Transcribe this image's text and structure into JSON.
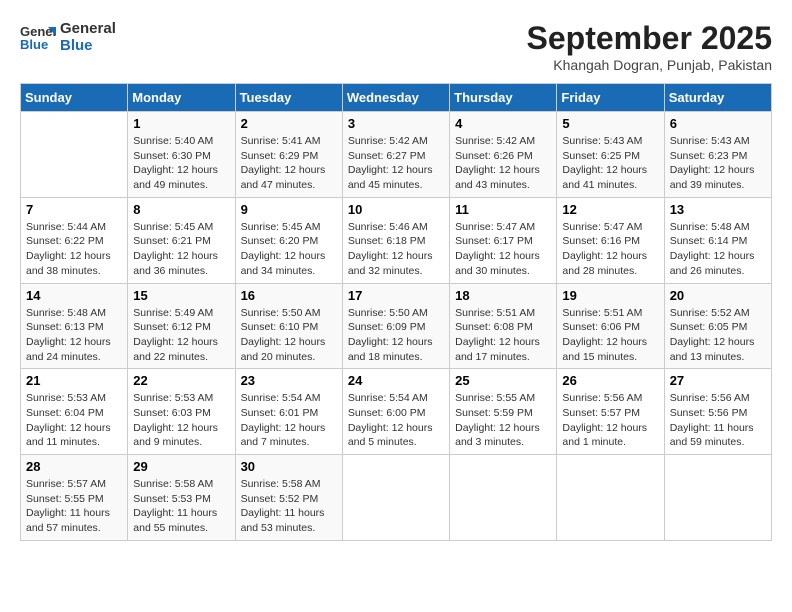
{
  "logo": {
    "line1": "General",
    "line2": "Blue"
  },
  "title": "September 2025",
  "subtitle": "Khangah Dogran, Punjab, Pakistan",
  "weekdays": [
    "Sunday",
    "Monday",
    "Tuesday",
    "Wednesday",
    "Thursday",
    "Friday",
    "Saturday"
  ],
  "weeks": [
    [
      {
        "day": "",
        "info": ""
      },
      {
        "day": "1",
        "info": "Sunrise: 5:40 AM\nSunset: 6:30 PM\nDaylight: 12 hours\nand 49 minutes."
      },
      {
        "day": "2",
        "info": "Sunrise: 5:41 AM\nSunset: 6:29 PM\nDaylight: 12 hours\nand 47 minutes."
      },
      {
        "day": "3",
        "info": "Sunrise: 5:42 AM\nSunset: 6:27 PM\nDaylight: 12 hours\nand 45 minutes."
      },
      {
        "day": "4",
        "info": "Sunrise: 5:42 AM\nSunset: 6:26 PM\nDaylight: 12 hours\nand 43 minutes."
      },
      {
        "day": "5",
        "info": "Sunrise: 5:43 AM\nSunset: 6:25 PM\nDaylight: 12 hours\nand 41 minutes."
      },
      {
        "day": "6",
        "info": "Sunrise: 5:43 AM\nSunset: 6:23 PM\nDaylight: 12 hours\nand 39 minutes."
      }
    ],
    [
      {
        "day": "7",
        "info": "Sunrise: 5:44 AM\nSunset: 6:22 PM\nDaylight: 12 hours\nand 38 minutes."
      },
      {
        "day": "8",
        "info": "Sunrise: 5:45 AM\nSunset: 6:21 PM\nDaylight: 12 hours\nand 36 minutes."
      },
      {
        "day": "9",
        "info": "Sunrise: 5:45 AM\nSunset: 6:20 PM\nDaylight: 12 hours\nand 34 minutes."
      },
      {
        "day": "10",
        "info": "Sunrise: 5:46 AM\nSunset: 6:18 PM\nDaylight: 12 hours\nand 32 minutes."
      },
      {
        "day": "11",
        "info": "Sunrise: 5:47 AM\nSunset: 6:17 PM\nDaylight: 12 hours\nand 30 minutes."
      },
      {
        "day": "12",
        "info": "Sunrise: 5:47 AM\nSunset: 6:16 PM\nDaylight: 12 hours\nand 28 minutes."
      },
      {
        "day": "13",
        "info": "Sunrise: 5:48 AM\nSunset: 6:14 PM\nDaylight: 12 hours\nand 26 minutes."
      }
    ],
    [
      {
        "day": "14",
        "info": "Sunrise: 5:48 AM\nSunset: 6:13 PM\nDaylight: 12 hours\nand 24 minutes."
      },
      {
        "day": "15",
        "info": "Sunrise: 5:49 AM\nSunset: 6:12 PM\nDaylight: 12 hours\nand 22 minutes."
      },
      {
        "day": "16",
        "info": "Sunrise: 5:50 AM\nSunset: 6:10 PM\nDaylight: 12 hours\nand 20 minutes."
      },
      {
        "day": "17",
        "info": "Sunrise: 5:50 AM\nSunset: 6:09 PM\nDaylight: 12 hours\nand 18 minutes."
      },
      {
        "day": "18",
        "info": "Sunrise: 5:51 AM\nSunset: 6:08 PM\nDaylight: 12 hours\nand 17 minutes."
      },
      {
        "day": "19",
        "info": "Sunrise: 5:51 AM\nSunset: 6:06 PM\nDaylight: 12 hours\nand 15 minutes."
      },
      {
        "day": "20",
        "info": "Sunrise: 5:52 AM\nSunset: 6:05 PM\nDaylight: 12 hours\nand 13 minutes."
      }
    ],
    [
      {
        "day": "21",
        "info": "Sunrise: 5:53 AM\nSunset: 6:04 PM\nDaylight: 12 hours\nand 11 minutes."
      },
      {
        "day": "22",
        "info": "Sunrise: 5:53 AM\nSunset: 6:03 PM\nDaylight: 12 hours\nand 9 minutes."
      },
      {
        "day": "23",
        "info": "Sunrise: 5:54 AM\nSunset: 6:01 PM\nDaylight: 12 hours\nand 7 minutes."
      },
      {
        "day": "24",
        "info": "Sunrise: 5:54 AM\nSunset: 6:00 PM\nDaylight: 12 hours\nand 5 minutes."
      },
      {
        "day": "25",
        "info": "Sunrise: 5:55 AM\nSunset: 5:59 PM\nDaylight: 12 hours\nand 3 minutes."
      },
      {
        "day": "26",
        "info": "Sunrise: 5:56 AM\nSunset: 5:57 PM\nDaylight: 12 hours\nand 1 minute."
      },
      {
        "day": "27",
        "info": "Sunrise: 5:56 AM\nSunset: 5:56 PM\nDaylight: 11 hours\nand 59 minutes."
      }
    ],
    [
      {
        "day": "28",
        "info": "Sunrise: 5:57 AM\nSunset: 5:55 PM\nDaylight: 11 hours\nand 57 minutes."
      },
      {
        "day": "29",
        "info": "Sunrise: 5:58 AM\nSunset: 5:53 PM\nDaylight: 11 hours\nand 55 minutes."
      },
      {
        "day": "30",
        "info": "Sunrise: 5:58 AM\nSunset: 5:52 PM\nDaylight: 11 hours\nand 53 minutes."
      },
      {
        "day": "",
        "info": ""
      },
      {
        "day": "",
        "info": ""
      },
      {
        "day": "",
        "info": ""
      },
      {
        "day": "",
        "info": ""
      }
    ]
  ]
}
